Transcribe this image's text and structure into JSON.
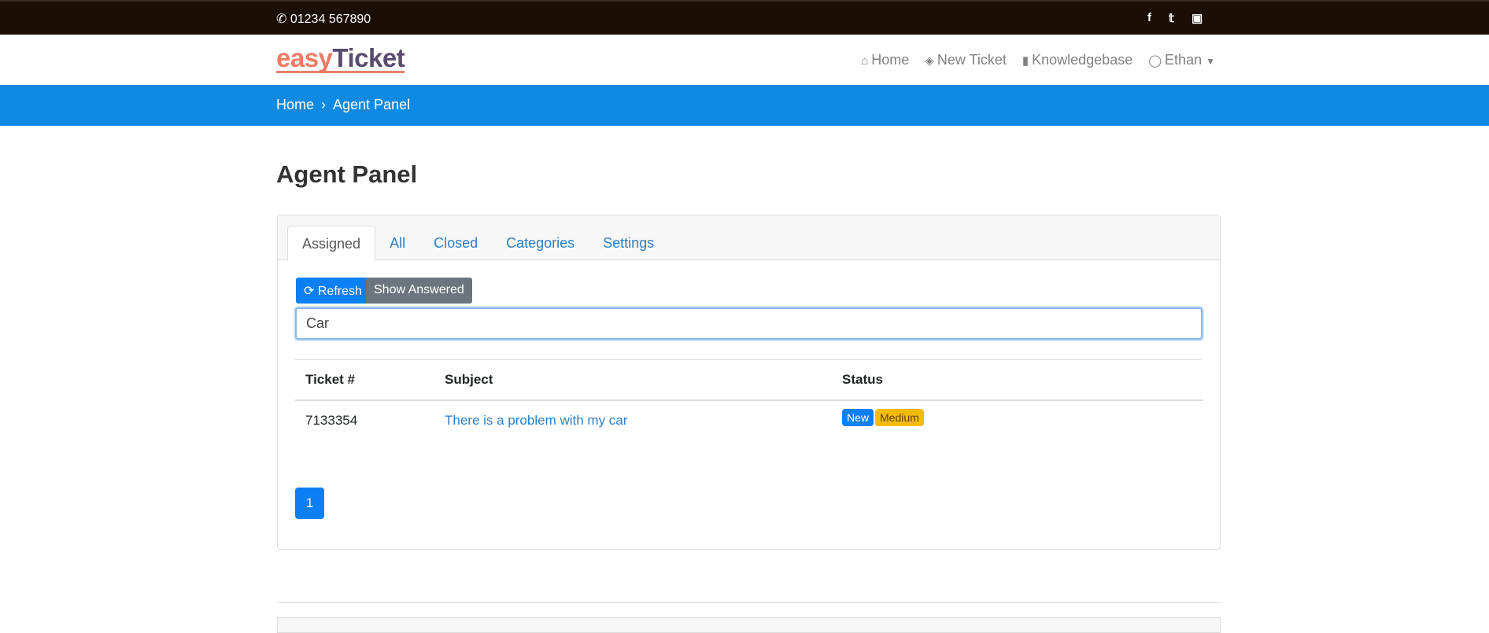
{
  "topbar": {
    "phone": "01234 567890",
    "social": [
      "facebook",
      "twitter",
      "instagram"
    ]
  },
  "brand": {
    "part1": "easy",
    "part2": "Ticket"
  },
  "nav": {
    "home": "Home",
    "new_ticket": "New Ticket",
    "knowledgebase": "Knowledgebase",
    "user": "Ethan"
  },
  "breadcrumb": {
    "home": "Home",
    "current": "Agent Panel"
  },
  "page_title": "Agent Panel",
  "tabs": [
    "Assigned",
    "All",
    "Closed",
    "Categories",
    "Settings"
  ],
  "actions": {
    "refresh": "Refresh",
    "show_answered": "Show Answered"
  },
  "search": {
    "value": "Car"
  },
  "table": {
    "headers": [
      "Ticket #",
      "Subject",
      "Status"
    ],
    "rows": [
      {
        "ticket": "7133354",
        "subject": "There is a problem with my car",
        "status": "New",
        "priority": "Medium"
      }
    ]
  },
  "pagination": {
    "current": "1"
  },
  "colors": {
    "accent": "#0f8ae2",
    "primary": "#0d7ff5",
    "warning": "#f5bb0c",
    "topbar": "#1b0e04"
  }
}
